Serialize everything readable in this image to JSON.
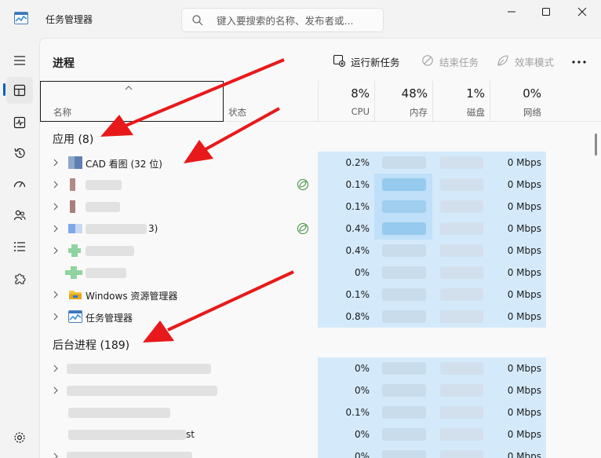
{
  "window": {
    "title": "任务管理器"
  },
  "search": {
    "placeholder": "键入要搜索的名称、发布者或..."
  },
  "toolbar": {
    "page_title": "进程",
    "run_new_task": "运行新任务",
    "end_task": "结束任务",
    "efficiency_mode": "效率模式"
  },
  "columns": {
    "name": "名称",
    "status": "状态",
    "cpu": {
      "pct": "8%",
      "label": "CPU"
    },
    "memory": {
      "pct": "48%",
      "label": "内存"
    },
    "disk": {
      "pct": "1%",
      "label": "磁盘"
    },
    "network": {
      "pct": "0%",
      "label": "网络"
    }
  },
  "groups": {
    "apps": "应用 (8)",
    "background": "后台进程 (189)"
  },
  "apps": [
    {
      "name": "CAD      看图 (32 位)",
      "cpu": "0.2%",
      "net": "0 Mbps"
    },
    {
      "name": "",
      "cpu": "0.1%",
      "net": "0 Mbps"
    },
    {
      "name": "",
      "cpu": "0.1%",
      "net": "0 Mbps"
    },
    {
      "name": "3)",
      "cpu": "0.4%",
      "net": "0 Mbps"
    },
    {
      "name": "",
      "cpu": "0.4%",
      "net": "0 Mbps"
    },
    {
      "name": "",
      "cpu": "0%",
      "net": "0 Mbps"
    },
    {
      "name": "Windows 资源管理器",
      "cpu": "0.1%",
      "net": "0 Mbps"
    },
    {
      "name": "任务管理器",
      "cpu": "0.8%",
      "net": "0 Mbps"
    }
  ],
  "background": [
    {
      "name": "",
      "cpu": "0%",
      "net": "0 Mbps"
    },
    {
      "name": "",
      "cpu": "0%",
      "net": "0 Mbps"
    },
    {
      "name": "",
      "cpu": "0.1%",
      "net": "0 Mbps"
    },
    {
      "name": "st",
      "cpu": "0%",
      "net": "0 Mbps"
    },
    {
      "name": "",
      "cpu": "0%",
      "net": "0 Mbps"
    }
  ],
  "colors": {
    "accent": "#005fb8",
    "annotation_arrow": "#e8191a",
    "heat_light": "#d4eafb",
    "heat_medium": "#bfe0f8"
  }
}
